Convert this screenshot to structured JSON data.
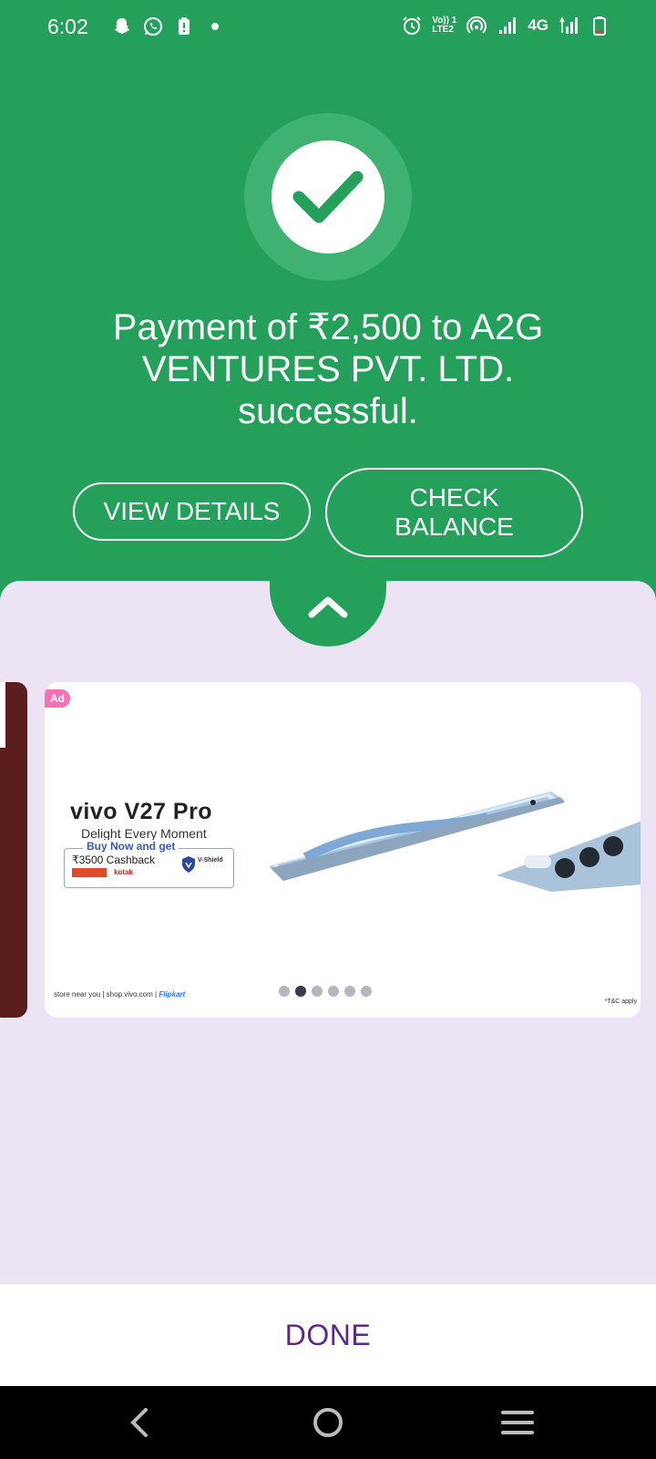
{
  "status_bar": {
    "time": "6:02",
    "network_label": "4G",
    "volte_label": "Vo)) 1",
    "lte_label": "LTE2"
  },
  "payment": {
    "message": "Payment of ₹2,500 to A2G VENTURES PVT. LTD. successful.",
    "view_details_label": "VIEW DETAILS",
    "check_balance_label": "CHECK BALANCE"
  },
  "ad": {
    "badge": "Ad",
    "brand": "vivo V27 Pro",
    "tagline": "Delight Every Moment",
    "offer_heading": "Buy Now and get",
    "cashback": "₹3500 Cashback",
    "bank": "kotak",
    "vshield": "V-Shield",
    "footer": "store near you | shop.vivo.com |",
    "flipkart": "Flipkart",
    "tc": "*T&C apply",
    "active_dot": 2,
    "dot_count": 6
  },
  "done_label": "DONE",
  "colors": {
    "green": "#24a05b",
    "lavender": "#ece3f5",
    "done_purple": "#5b2a86"
  }
}
